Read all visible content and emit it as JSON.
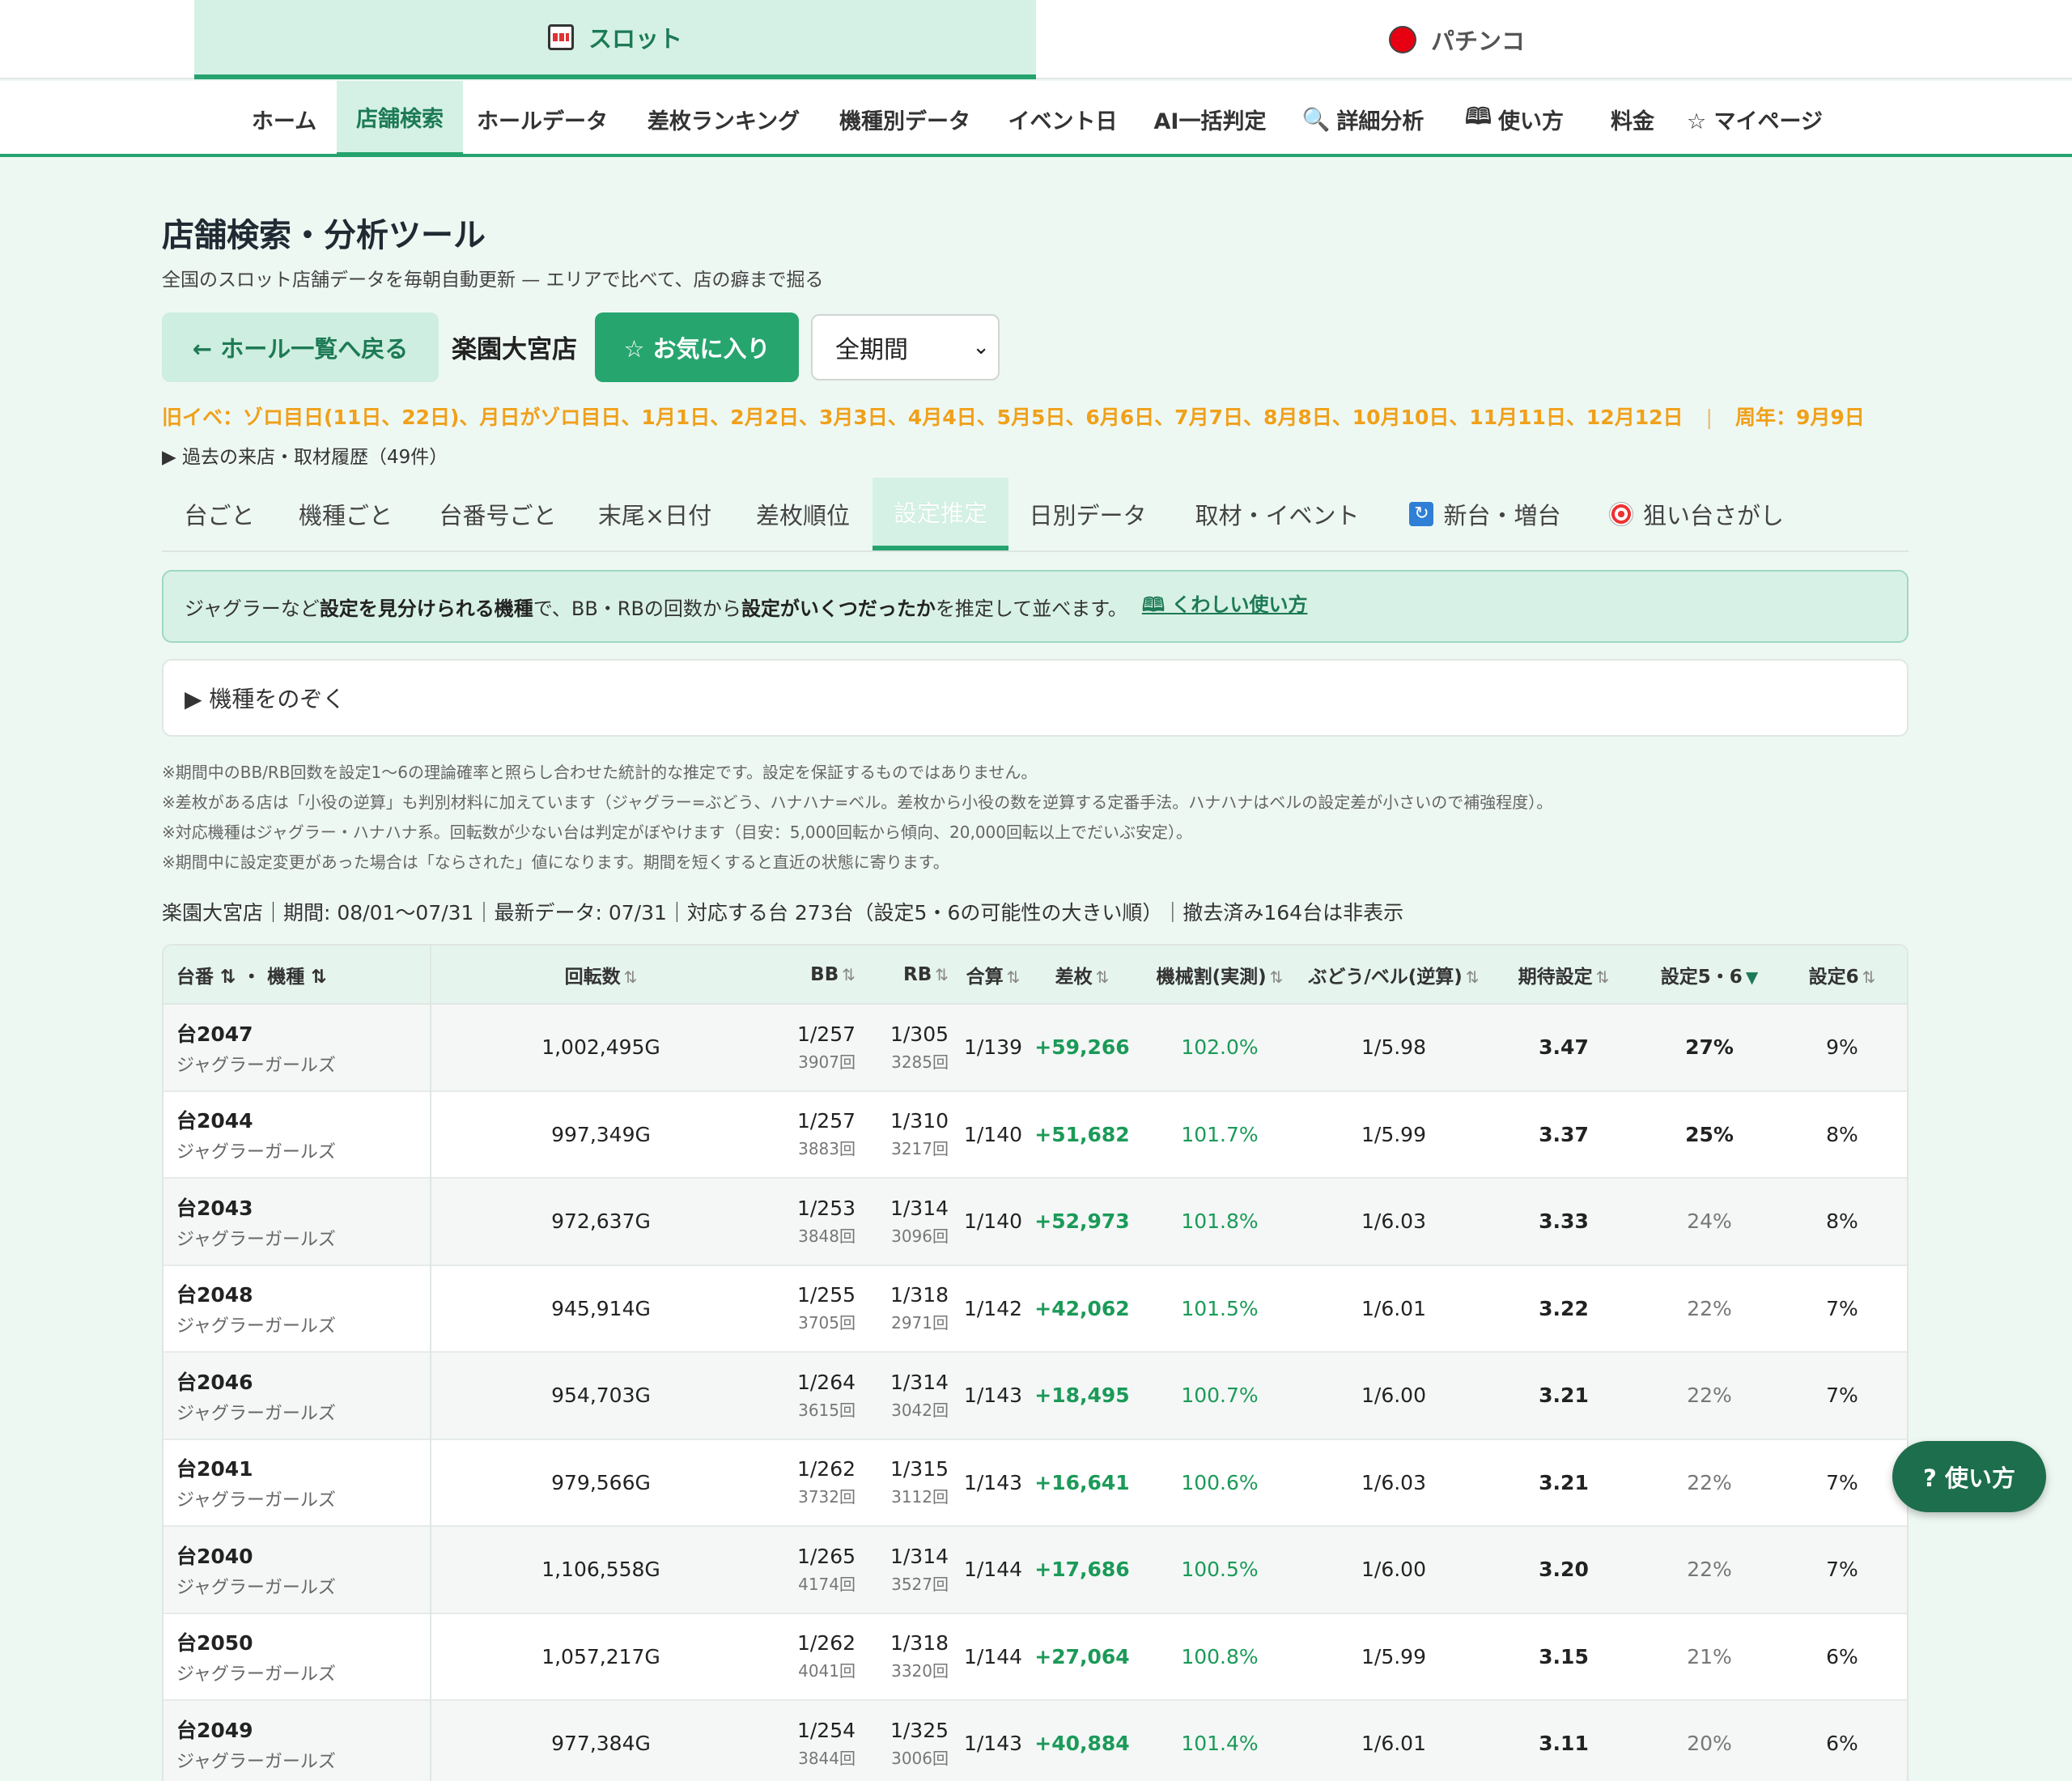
{
  "mode_tabs": {
    "slot": "スロット",
    "pachinko": "パチンコ"
  },
  "nav": [
    "ホーム",
    "店舗検索",
    "ホールデータ",
    "差枚ランキング",
    "機種別データ",
    "イベント日",
    "AI一括判定",
    "詳細分析",
    "使い方",
    "料金",
    "☆ マイページ"
  ],
  "header": {
    "title": "店舗検索・分析ツール",
    "subtitle": "全国のスロット店舗データを毎朝自動更新 — エリアで比べて、店の癖まで掘る",
    "back_button": "← ホール一覧へ戻る",
    "hall_name": "楽園大宮店",
    "fav_button": "☆ お気に入り",
    "period": "全期間",
    "event_line": "旧イベ：ゾロ目日(11日、22日)、月日がゾロ目日、1月1日、2月2日、3月3日、4月4日、5月5日、6月6日、7月7日、8月8日、10月10日、11月11日、12月12日",
    "event_sep": "|",
    "anniversary": "周年：9月9日",
    "history": "▶ 過去の来店・取材履歴（49件）"
  },
  "subtabs": [
    "台ごと",
    "機種ごと",
    "台番号ごと",
    "末尾×日付",
    "差枚順位",
    "設定推定",
    "日別データ",
    "取材・イベント",
    "新台・増台",
    "狙い台さがし"
  ],
  "info": {
    "p1": "ジャグラーなど",
    "b1": "設定を見分けられる機種",
    "p2": "で、BB・RBの回数から",
    "b2": "設定がいくつだったか",
    "p3": "を推定して並べます。",
    "link": "くわしい使い方"
  },
  "exclude": "▶ 機種をのぞく",
  "notes": [
    "※期間中のBB/RB回数を設定1〜6の理論確率と照らし合わせた統計的な推定です。設定を保証するものではありません。",
    "※差枚がある店は「小役の逆算」も判別材料に加えています（ジャグラー=ぶどう、ハナハナ=ベル。差枚から小役の数を逆算する定番手法。ハナハナはベルの設定差が小さいので補強程度）。",
    "※対応機種はジャグラー・ハナハナ系。回転数が少ない台は判定がぼやけます（目安：5,000回転から傾向、20,000回転以上でだいぶ安定）。",
    "※期間中に設定変更があった場合は「ならされた」値になります。期間を短くすると直近の状態に寄ります。"
  ],
  "summary": "楽園大宮店｜期間: 08/01〜07/31｜最新データ: 07/31｜対応する台 273台（設定5・6の可能性の大きい順）｜撤去済み164台は非表示",
  "table": {
    "headers": {
      "name": "台番 ⇅ ・ 機種 ⇅",
      "spins": "回転数",
      "bb": "BB",
      "rb": "RB",
      "total": "合算",
      "diff": "差枚",
      "rate": "機械割(実測)",
      "grape": "ぶどう/ベル(逆算)",
      "expected": "期待設定",
      "s56": "設定5・6",
      "s6": "設定6"
    },
    "rows": [
      {
        "num": "台2047",
        "machine": "ジャグラーガールズ",
        "spins": "1,002,495G",
        "bb": "1/257",
        "bb_count": "3907回",
        "rb": "1/305",
        "rb_count": "3285回",
        "total": "1/139",
        "diff": "+59,266",
        "rate": "102.0%",
        "grape": "1/5.98",
        "expected": "3.47",
        "s56": "27%",
        "s6": "9%"
      },
      {
        "num": "台2044",
        "machine": "ジャグラーガールズ",
        "spins": "997,349G",
        "bb": "1/257",
        "bb_count": "3883回",
        "rb": "1/310",
        "rb_count": "3217回",
        "total": "1/140",
        "diff": "+51,682",
        "rate": "101.7%",
        "grape": "1/5.99",
        "expected": "3.37",
        "s56": "25%",
        "s6": "8%"
      },
      {
        "num": "台2043",
        "machine": "ジャグラーガールズ",
        "spins": "972,637G",
        "bb": "1/253",
        "bb_count": "3848回",
        "rb": "1/314",
        "rb_count": "3096回",
        "total": "1/140",
        "diff": "+52,973",
        "rate": "101.8%",
        "grape": "1/6.03",
        "expected": "3.33",
        "s56": "24%",
        "s6": "8%"
      },
      {
        "num": "台2048",
        "machine": "ジャグラーガールズ",
        "spins": "945,914G",
        "bb": "1/255",
        "bb_count": "3705回",
        "rb": "1/318",
        "rb_count": "2971回",
        "total": "1/142",
        "diff": "+42,062",
        "rate": "101.5%",
        "grape": "1/6.01",
        "expected": "3.22",
        "s56": "22%",
        "s6": "7%"
      },
      {
        "num": "台2046",
        "machine": "ジャグラーガールズ",
        "spins": "954,703G",
        "bb": "1/264",
        "bb_count": "3615回",
        "rb": "1/314",
        "rb_count": "3042回",
        "total": "1/143",
        "diff": "+18,495",
        "rate": "100.7%",
        "grape": "1/6.00",
        "expected": "3.21",
        "s56": "22%",
        "s6": "7%"
      },
      {
        "num": "台2041",
        "machine": "ジャグラーガールズ",
        "spins": "979,566G",
        "bb": "1/262",
        "bb_count": "3732回",
        "rb": "1/315",
        "rb_count": "3112回",
        "total": "1/143",
        "diff": "+16,641",
        "rate": "100.6%",
        "grape": "1/6.03",
        "expected": "3.21",
        "s56": "22%",
        "s6": "7%"
      },
      {
        "num": "台2040",
        "machine": "ジャグラーガールズ",
        "spins": "1,106,558G",
        "bb": "1/265",
        "bb_count": "4174回",
        "rb": "1/314",
        "rb_count": "3527回",
        "total": "1/144",
        "diff": "+17,686",
        "rate": "100.5%",
        "grape": "1/6.00",
        "expected": "3.20",
        "s56": "22%",
        "s6": "7%"
      },
      {
        "num": "台2050",
        "machine": "ジャグラーガールズ",
        "spins": "1,057,217G",
        "bb": "1/262",
        "bb_count": "4041回",
        "rb": "1/318",
        "rb_count": "3320回",
        "total": "1/144",
        "diff": "+27,064",
        "rate": "100.8%",
        "grape": "1/5.99",
        "expected": "3.15",
        "s56": "21%",
        "s6": "6%"
      },
      {
        "num": "台2049",
        "machine": "ジャグラーガールズ",
        "spins": "977,384G",
        "bb": "1/254",
        "bb_count": "3844回",
        "rb": "1/325",
        "rb_count": "3006回",
        "total": "1/143",
        "diff": "+40,884",
        "rate": "101.4%",
        "grape": "1/6.01",
        "expected": "3.11",
        "s56": "20%",
        "s6": "6%"
      }
    ]
  },
  "help_button": "? 使い方",
  "colors": {
    "accent": "#25a36e",
    "event": "#f0a01a",
    "positive": "#1b9a58"
  }
}
